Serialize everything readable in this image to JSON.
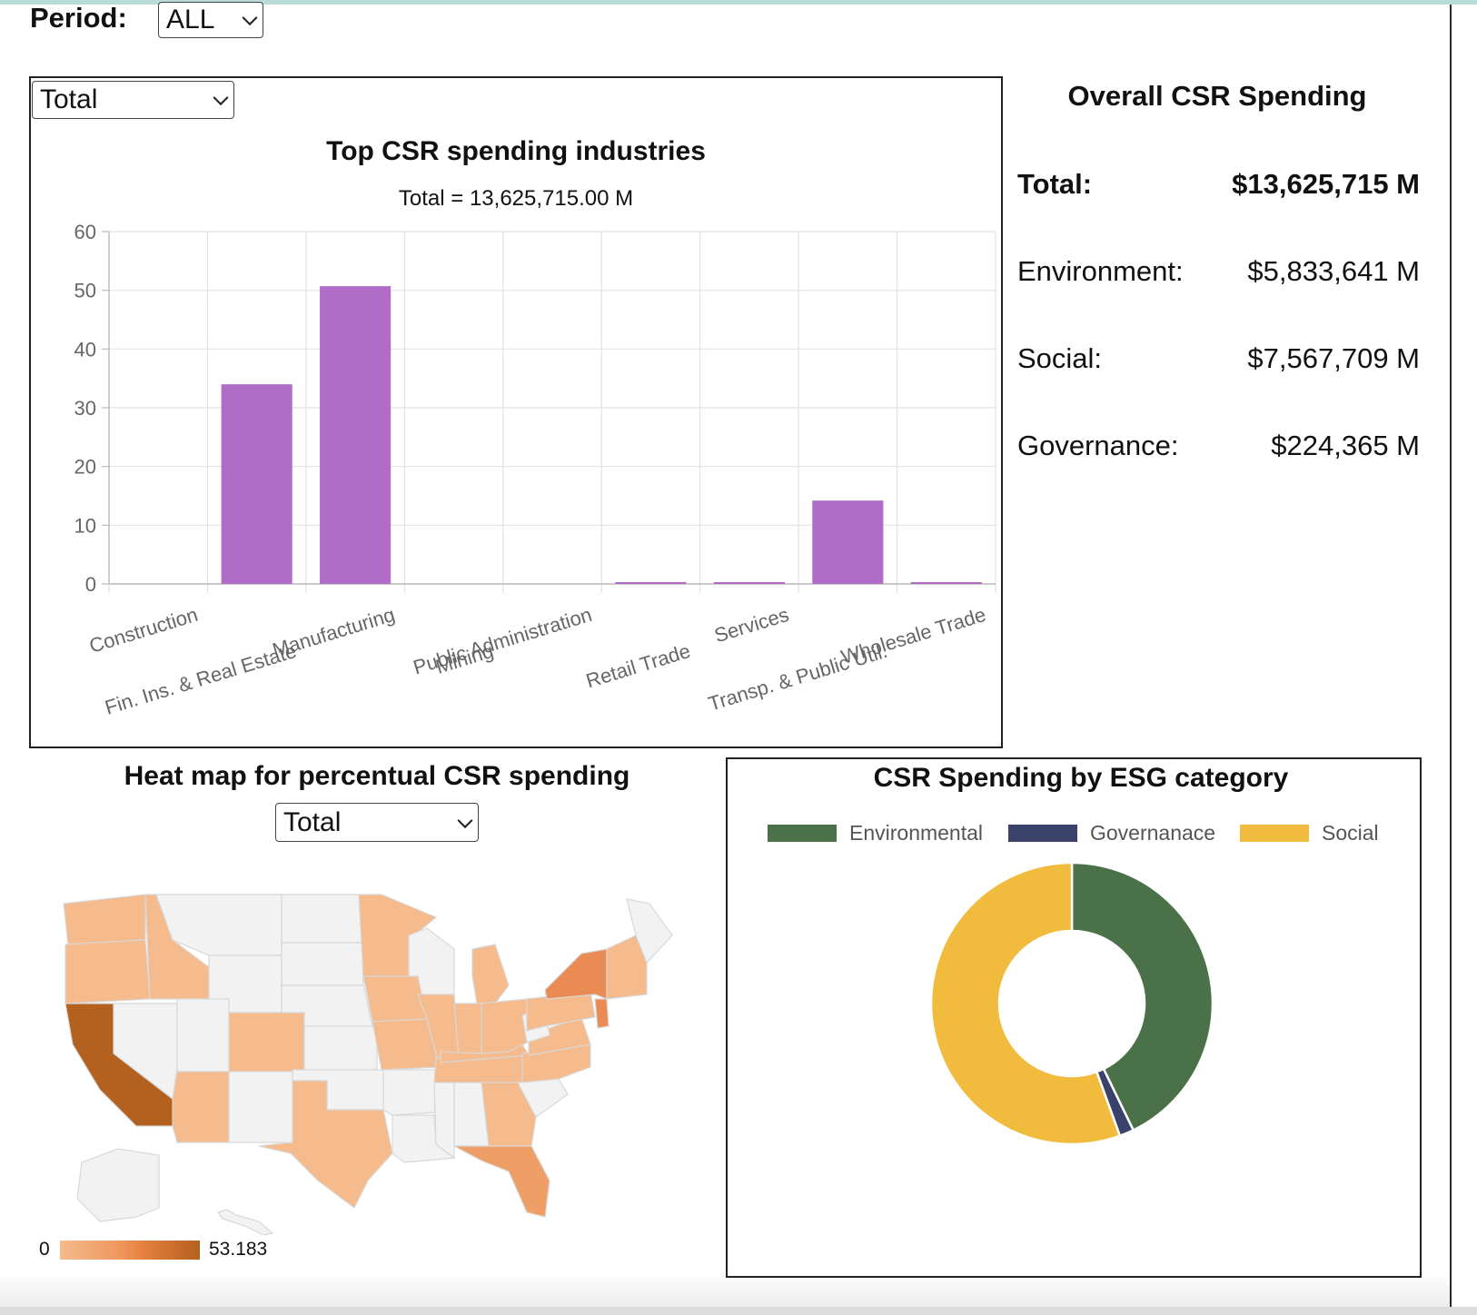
{
  "period": {
    "label": "Period:",
    "value": "ALL"
  },
  "bar_panel": {
    "select_value": "Total",
    "title": "Top CSR spending industries",
    "subtitle": "Total = 13,625,715.00 M",
    "bar_color": "#b06cc6"
  },
  "summary": {
    "title": "Overall CSR Spending",
    "rows": [
      {
        "label": "Total:",
        "value": "$13,625,715 M"
      },
      {
        "label": "Environment:",
        "value": "$5,833,641 M"
      },
      {
        "label": "Social:",
        "value": "$7,567,709 M"
      },
      {
        "label": "Governance:",
        "value": "$224,365 M"
      }
    ]
  },
  "heatmap": {
    "title": "Heat map for percentual CSR spending",
    "select_value": "Total",
    "legend_min": "0",
    "legend_max": "53.183",
    "colors": {
      "none": "#f2f2f2",
      "low": "#f5bb8d",
      "mid": "#e98b52",
      "high": "#b4611f"
    }
  },
  "esg": {
    "title": "CSR Spending by ESG category",
    "legend": [
      {
        "name": "Environmental",
        "color": "#4a7148"
      },
      {
        "name": "Governanace",
        "color": "#3b4269"
      },
      {
        "name": "Social",
        "color": "#f1bb3d"
      }
    ]
  },
  "chart_data": [
    {
      "type": "bar",
      "title": "Top CSR spending industries",
      "subtitle": "Total = 13,625,715.00 M",
      "categories": [
        "Construction",
        "Fin. Ins. & Real Estate",
        "Manufacturing",
        "Mining",
        "Public Administration",
        "Retail Trade",
        "Services",
        "Transp. & Public Util.",
        "Wholesale Trade"
      ],
      "values": [
        0,
        34,
        50.7,
        0,
        0,
        0.3,
        0.2,
        14.2,
        0.05
      ],
      "ylim": [
        0,
        60
      ],
      "yticks": [
        0,
        10,
        20,
        30,
        40,
        50,
        60
      ],
      "grid": true
    },
    {
      "type": "pie",
      "title": "CSR Spending by ESG category",
      "categories": [
        "Environmental",
        "Governanace",
        "Social"
      ],
      "values": [
        5833641,
        224365,
        7567709
      ],
      "colors": [
        "#4a7148",
        "#3b4269",
        "#f1bb3d"
      ],
      "legend": "top"
    }
  ]
}
